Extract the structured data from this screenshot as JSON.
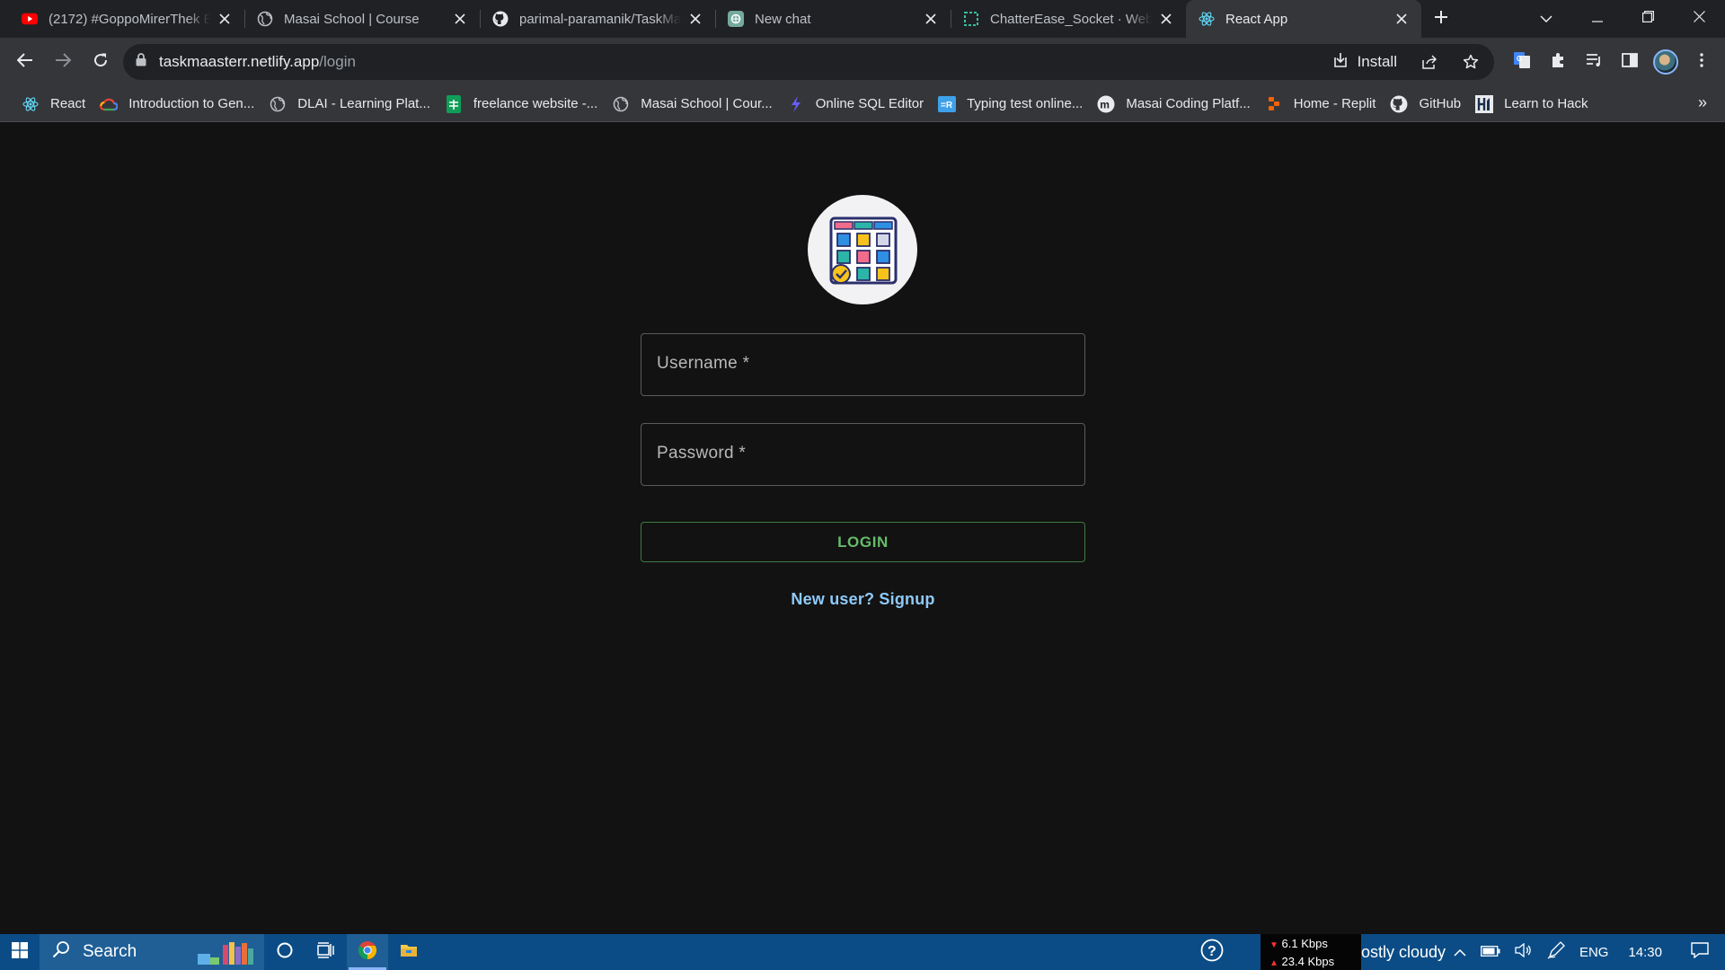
{
  "tabs": [
    {
      "title": "(2172) #GoppoMirerThek Ep",
      "icon": "youtube-icon",
      "active": false
    },
    {
      "title": "Masai School | Course",
      "icon": "globe-icon",
      "active": false
    },
    {
      "title": "parimal-paramanik/TaskMa",
      "icon": "github-icon",
      "active": false
    },
    {
      "title": "New chat",
      "icon": "chatgpt-icon",
      "active": false
    },
    {
      "title": "ChatterEase_Socket · Web S",
      "icon": "codesandbox-icon",
      "active": false
    },
    {
      "title": "React App",
      "icon": "react-icon",
      "active": true
    }
  ],
  "address_bar": {
    "host": "taskmaasterr.netlify.app",
    "path": "/login",
    "install_label": "Install"
  },
  "bookmarks": [
    {
      "label": "React",
      "icon": "react-icon"
    },
    {
      "label": "Introduction to Gen...",
      "icon": "google-cloud-icon"
    },
    {
      "label": "DLAI - Learning Plat...",
      "icon": "globe-icon"
    },
    {
      "label": "freelance website -...",
      "icon": "sheets-icon"
    },
    {
      "label": "Masai School | Cour...",
      "icon": "globe-icon"
    },
    {
      "label": "Online SQL Editor",
      "icon": "sql-editor-icon"
    },
    {
      "label": "Typing test online...",
      "icon": "typing-icon"
    },
    {
      "label": "Masai Coding Platf...",
      "icon": "masai-icon"
    },
    {
      "label": "Home - Replit",
      "icon": "replit-icon"
    },
    {
      "label": "GitHub",
      "icon": "github-icon"
    },
    {
      "label": "Learn to Hack",
      "icon": "hackerrank-icon"
    }
  ],
  "bookmarks_overflow": "»",
  "login_form": {
    "username_label": "Username *",
    "password_label": "Password *",
    "login_button": "LOGIN",
    "signup_link": "New user? Signup"
  },
  "taskbar": {
    "search_label": "Search",
    "net_download": "6.1 Kbps",
    "net_upload": "23.4 Kbps",
    "weather": "ostly cloudy",
    "language": "ENG",
    "time": "14:30"
  },
  "colors": {
    "page_bg": "#121212",
    "accent_green": "#66bb6a",
    "link_blue": "#8fcaf9",
    "taskbar": "#0b4c86"
  }
}
